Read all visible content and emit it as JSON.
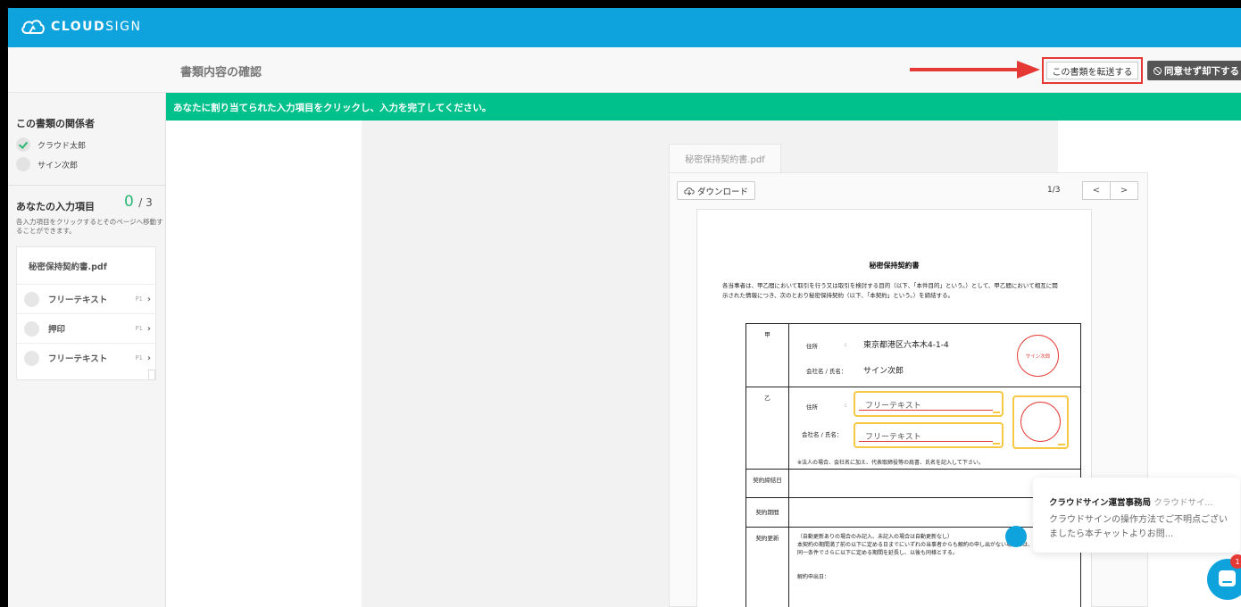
{
  "app": {
    "brand_prefix": "CLOUD",
    "brand_suffix": "SIGN"
  },
  "header": {
    "page_title": "書類内容の確認",
    "forward_label": "この書類を転送する",
    "decline_label": "同意せず却下する"
  },
  "notice": "あなたに割り当てられた入力項目をクリックし、入力を完了してください。",
  "sidebar": {
    "parties_heading": "この書類の関係者",
    "parties": [
      {
        "name": "クラウド太郎",
        "done": true
      },
      {
        "name": "サイン次郎",
        "done": false
      }
    ],
    "fields_heading": "あなたの入力項目",
    "count_done": "0",
    "count_total": "/ 3",
    "description": "各入力項目をクリックするとそのページへ移動することができます。",
    "file_name": "秘密保持契約書.pdf",
    "fields": [
      {
        "label": "フリーテキスト",
        "page": "P1"
      },
      {
        "label": "押印",
        "page": "P1"
      },
      {
        "label": "フリーテキスト",
        "page": "P1"
      }
    ]
  },
  "viewer": {
    "file_tab": "秘密保持契約書.pdf",
    "download_label": "ダウンロード",
    "page_indicator": "1/3",
    "prev": "<",
    "next": ">"
  },
  "document": {
    "title": "秘密保持契約書",
    "intro": "各当事者は、甲乙間において取引を行う又は取引を検討する目的（以下、「本件目的」という。）として、甲乙間において相互に開示された情報につき、次のとおり秘密保持契約（以下、「本契約」という。）を締結する。",
    "party_a_label": "甲",
    "party_b_label": "乙",
    "address_label": "住所",
    "colon": ":",
    "name_label": "会社名 / 氏名：",
    "party_a_address": "東京都港区六本木4-1-4",
    "party_a_name": "サイン次郎",
    "party_a_seal": "サイン次郎",
    "placeholder": "フリーテキスト",
    "corp_note": "※法人の場合、会社名に加え、代表取締役等の肩書、氏名を記入して下さい。",
    "date_label": "契約締結日",
    "period_label": "契約期間",
    "renewal_label": "契約更新",
    "renewal_line1": "（自動更新ありの場合のみ記入、未記入の場合は自動更新なし）",
    "renewal_line2": "本契約の期間満了前の以下に定める日までにいずれの当事者からも解約の申し出がない場合には、",
    "renewal_line3": "同一条件でさらに以下に定める期間を延長し、以後も同様とする。",
    "cancel_date_label": "解約申出日："
  },
  "chat": {
    "sender": "クラウドサイン運営事務局",
    "sender_sub": "クラウドサイ...",
    "message": "クラウドサインの操作方法でご不明点ございましたら本チャットよりお問...",
    "badge": "1"
  },
  "colors": {
    "topbar": "#0fa3dd",
    "notice": "#00c08b",
    "accent_red": "#e53935",
    "field_yellow": "#f7c843"
  }
}
